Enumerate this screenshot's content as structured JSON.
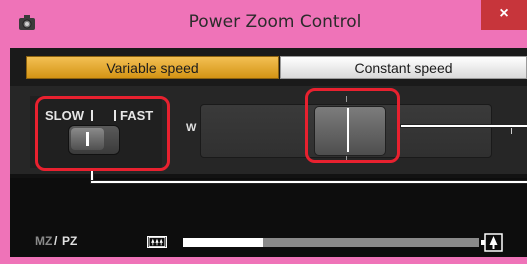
{
  "window": {
    "title": "Power Zoom Control",
    "close_glyph": "×"
  },
  "tabs": [
    {
      "label": "Variable speed",
      "selected": true
    },
    {
      "label": "Constant speed",
      "selected": false
    }
  ],
  "speed_switch": {
    "slow_label": "SLOW",
    "fast_label": "FAST",
    "position": "slow"
  },
  "zoom_slider": {
    "wide_label": "W",
    "position": "center"
  },
  "power_zoom": {
    "mz_label": "MZ",
    "separator": "/",
    "pz_label": "PZ",
    "active_mode": "PZ",
    "zoom_position_fraction": 0.27,
    "wide_icon": "wide-trees-icon",
    "tele_icon": "tele-tree-icon"
  },
  "colors": {
    "window_frame": "#ef73b8",
    "close_button": "#c7353b",
    "tab_selected": "#e4a730",
    "annotation_red": "#e8212f"
  }
}
